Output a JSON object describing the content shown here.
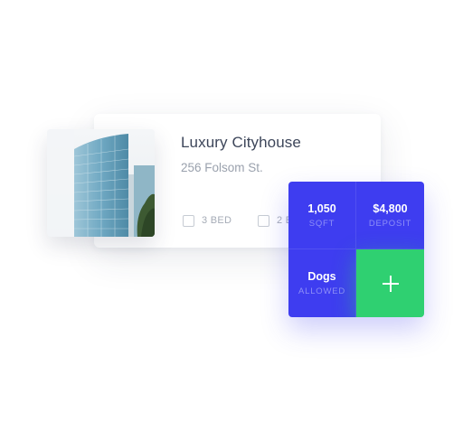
{
  "listing": {
    "title": "Luxury Cityhouse",
    "address": "256 Folsom St.",
    "amenities": [
      {
        "label": "3 BED"
      },
      {
        "label": "2 BATH"
      }
    ]
  },
  "stats": [
    {
      "value": "1,050",
      "label": "SQFT"
    },
    {
      "value": "$4,800",
      "label": "DEPOSIT"
    },
    {
      "value": "Dogs",
      "label": "ALLOWED"
    }
  ],
  "add_button": {
    "icon": "plus-icon"
  },
  "colors": {
    "panel": "#3e3df0",
    "accent_green": "#2fd071",
    "title_text": "#3d465a",
    "muted_text": "#9aa1ad"
  }
}
